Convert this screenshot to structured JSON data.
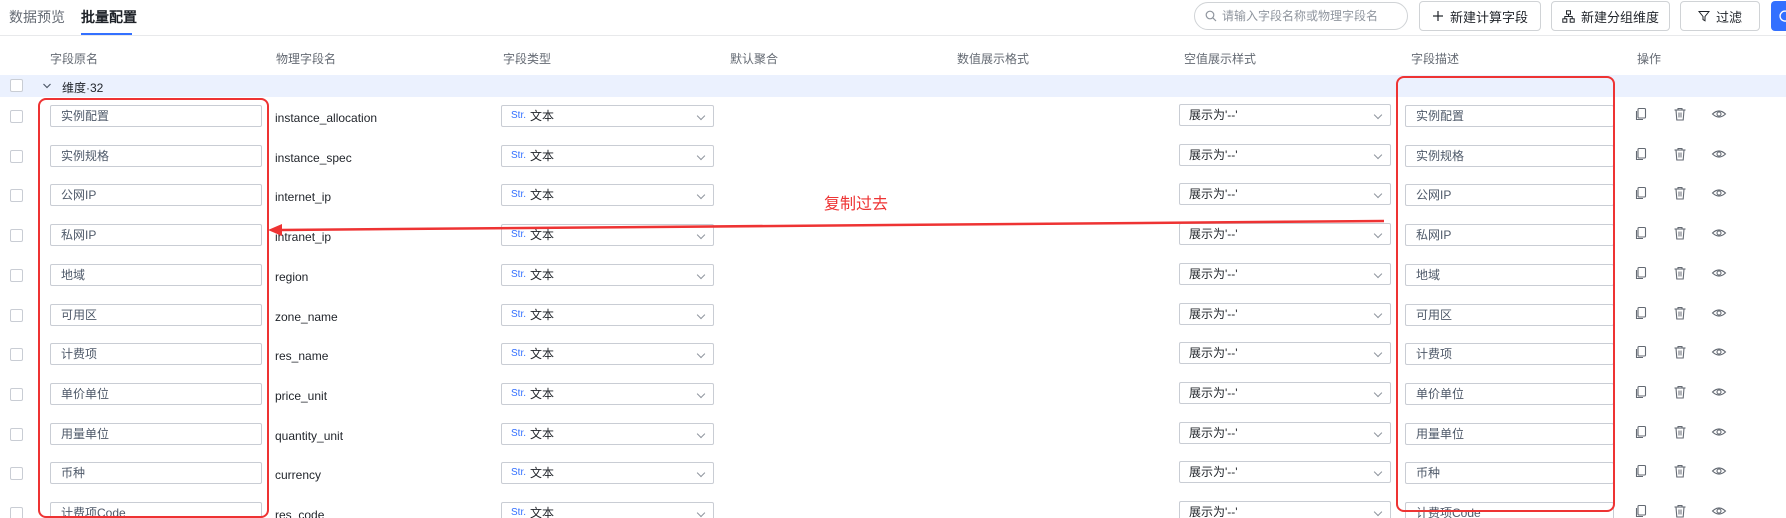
{
  "tabs": [
    {
      "label": "数据预览",
      "active": false
    },
    {
      "label": "批量配置",
      "active": true
    }
  ],
  "toolbar": {
    "search_placeholder": "请输入字段名称或物理字段名",
    "new_calc_field": "新建计算字段",
    "new_group_dim": "新建分组维度",
    "filter": "过滤"
  },
  "columns": [
    "字段原名",
    "物理字段名",
    "字段类型",
    "默认聚合",
    "数值展示格式",
    "空值展示样式",
    "字段描述",
    "操作"
  ],
  "group": {
    "label": "维度·32"
  },
  "type_option": {
    "tag": "Str.",
    "label": "文本"
  },
  "null_option": "展示为'--'",
  "rows": [
    {
      "original": "实例配置",
      "physical": "instance_allocation",
      "description": "实例配置"
    },
    {
      "original": "实例规格",
      "physical": "instance_spec",
      "description": "实例规格"
    },
    {
      "original": "公网IP",
      "physical": "internet_ip",
      "description": "公网IP"
    },
    {
      "original": "私网IP",
      "physical": "intranet_ip",
      "description": "私网IP"
    },
    {
      "original": "地域",
      "physical": "region",
      "description": "地域"
    },
    {
      "original": "可用区",
      "physical": "zone_name",
      "description": "可用区"
    },
    {
      "original": "计费项",
      "physical": "res_name",
      "description": "计费项"
    },
    {
      "original": "单价单位",
      "physical": "price_unit",
      "description": "单价单位"
    },
    {
      "original": "用量单位",
      "physical": "quantity_unit",
      "description": "用量单位"
    },
    {
      "original": "币种",
      "physical": "currency",
      "description": "币种"
    },
    {
      "original": "计费项Code",
      "physical": "res_code",
      "description": "计费项Code"
    }
  ],
  "annotation": {
    "text": "复制过去",
    "color": "#ee3333"
  },
  "colors": {
    "accent": "#3370ff",
    "group_bg": "#ebf1fe",
    "annotation_red": "#ee3333"
  }
}
